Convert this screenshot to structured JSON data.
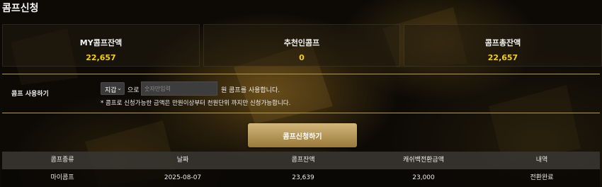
{
  "page": {
    "title": "콤프신청"
  },
  "stats": [
    {
      "label": "MY콤프잔액",
      "value": "22,657"
    },
    {
      "label": "추천인콤프",
      "value": "0"
    },
    {
      "label": "콤프총잔액",
      "value": "22,657"
    }
  ],
  "use_comp": {
    "label": "콤프 사용하기",
    "select_value": "지갑",
    "particle_text": "으로",
    "amount_placeholder": "숫자만입력",
    "suffix_text": "원 콤프를 사용합니다.",
    "note": "* 콤프로 신청가능한 금액은 만원이상부터 천원단위 까지만 신청가능합니다."
  },
  "apply_button": {
    "label": "콤프신청하기"
  },
  "table": {
    "headers": [
      "콤프종류",
      "날짜",
      "콤프잔액",
      "캐쉬백전환금액",
      "내역"
    ],
    "rows": [
      [
        "마이콤프",
        "2025-08-07",
        "23,639",
        "23,000",
        "전환완료"
      ]
    ]
  },
  "colors": {
    "accent_value": "#f6d100",
    "divider": "#b59a4a",
    "button": "#c2a25e"
  }
}
